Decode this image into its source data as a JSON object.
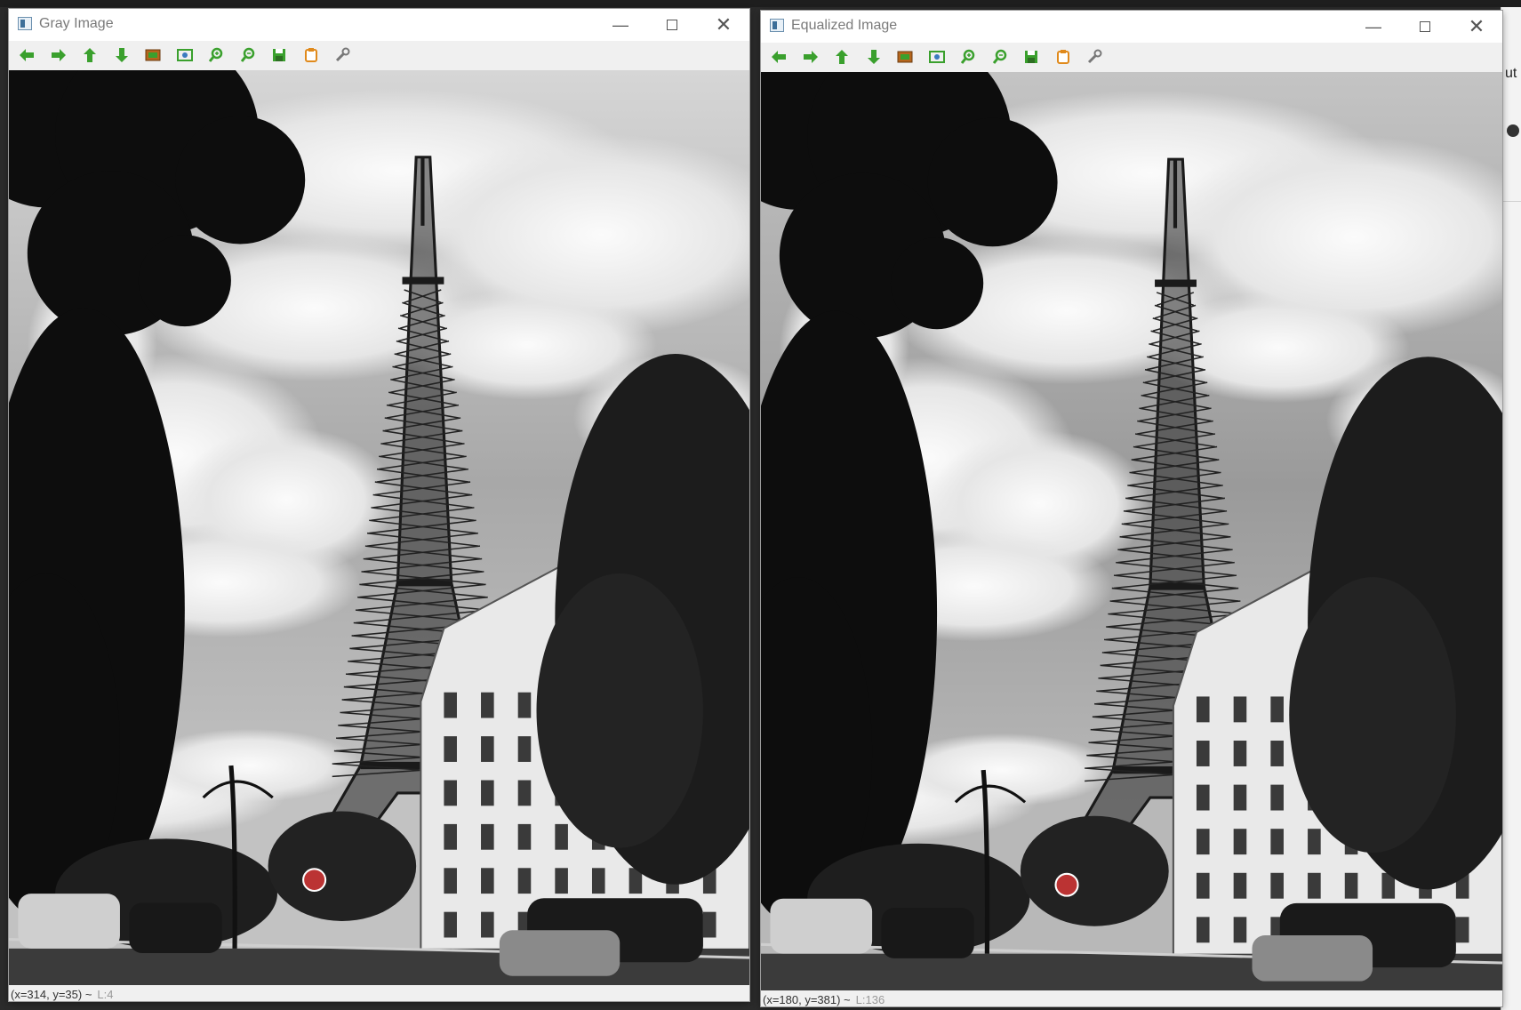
{
  "windows": [
    {
      "title": "Gray Image",
      "status": {
        "coords": "(x=314, y=35) ~",
        "pixel": "L:4"
      }
    },
    {
      "title": "Equalized Image",
      "status": {
        "coords": "(x=180, y=381) ~",
        "pixel": "L:136"
      }
    }
  ],
  "toolbar_icons": [
    "pan-left-icon",
    "pan-right-icon",
    "pan-up-icon",
    "pan-down-icon",
    "zoom-in-area-icon",
    "zoom-fit-icon",
    "zoom-in-icon",
    "zoom-out-icon",
    "save-icon",
    "copy-icon",
    "properties-icon"
  ],
  "side_peek": {
    "text": "ut"
  },
  "colors": {
    "toolbar_green": "#3aa02d",
    "accent_orange": "#e08a1c"
  }
}
